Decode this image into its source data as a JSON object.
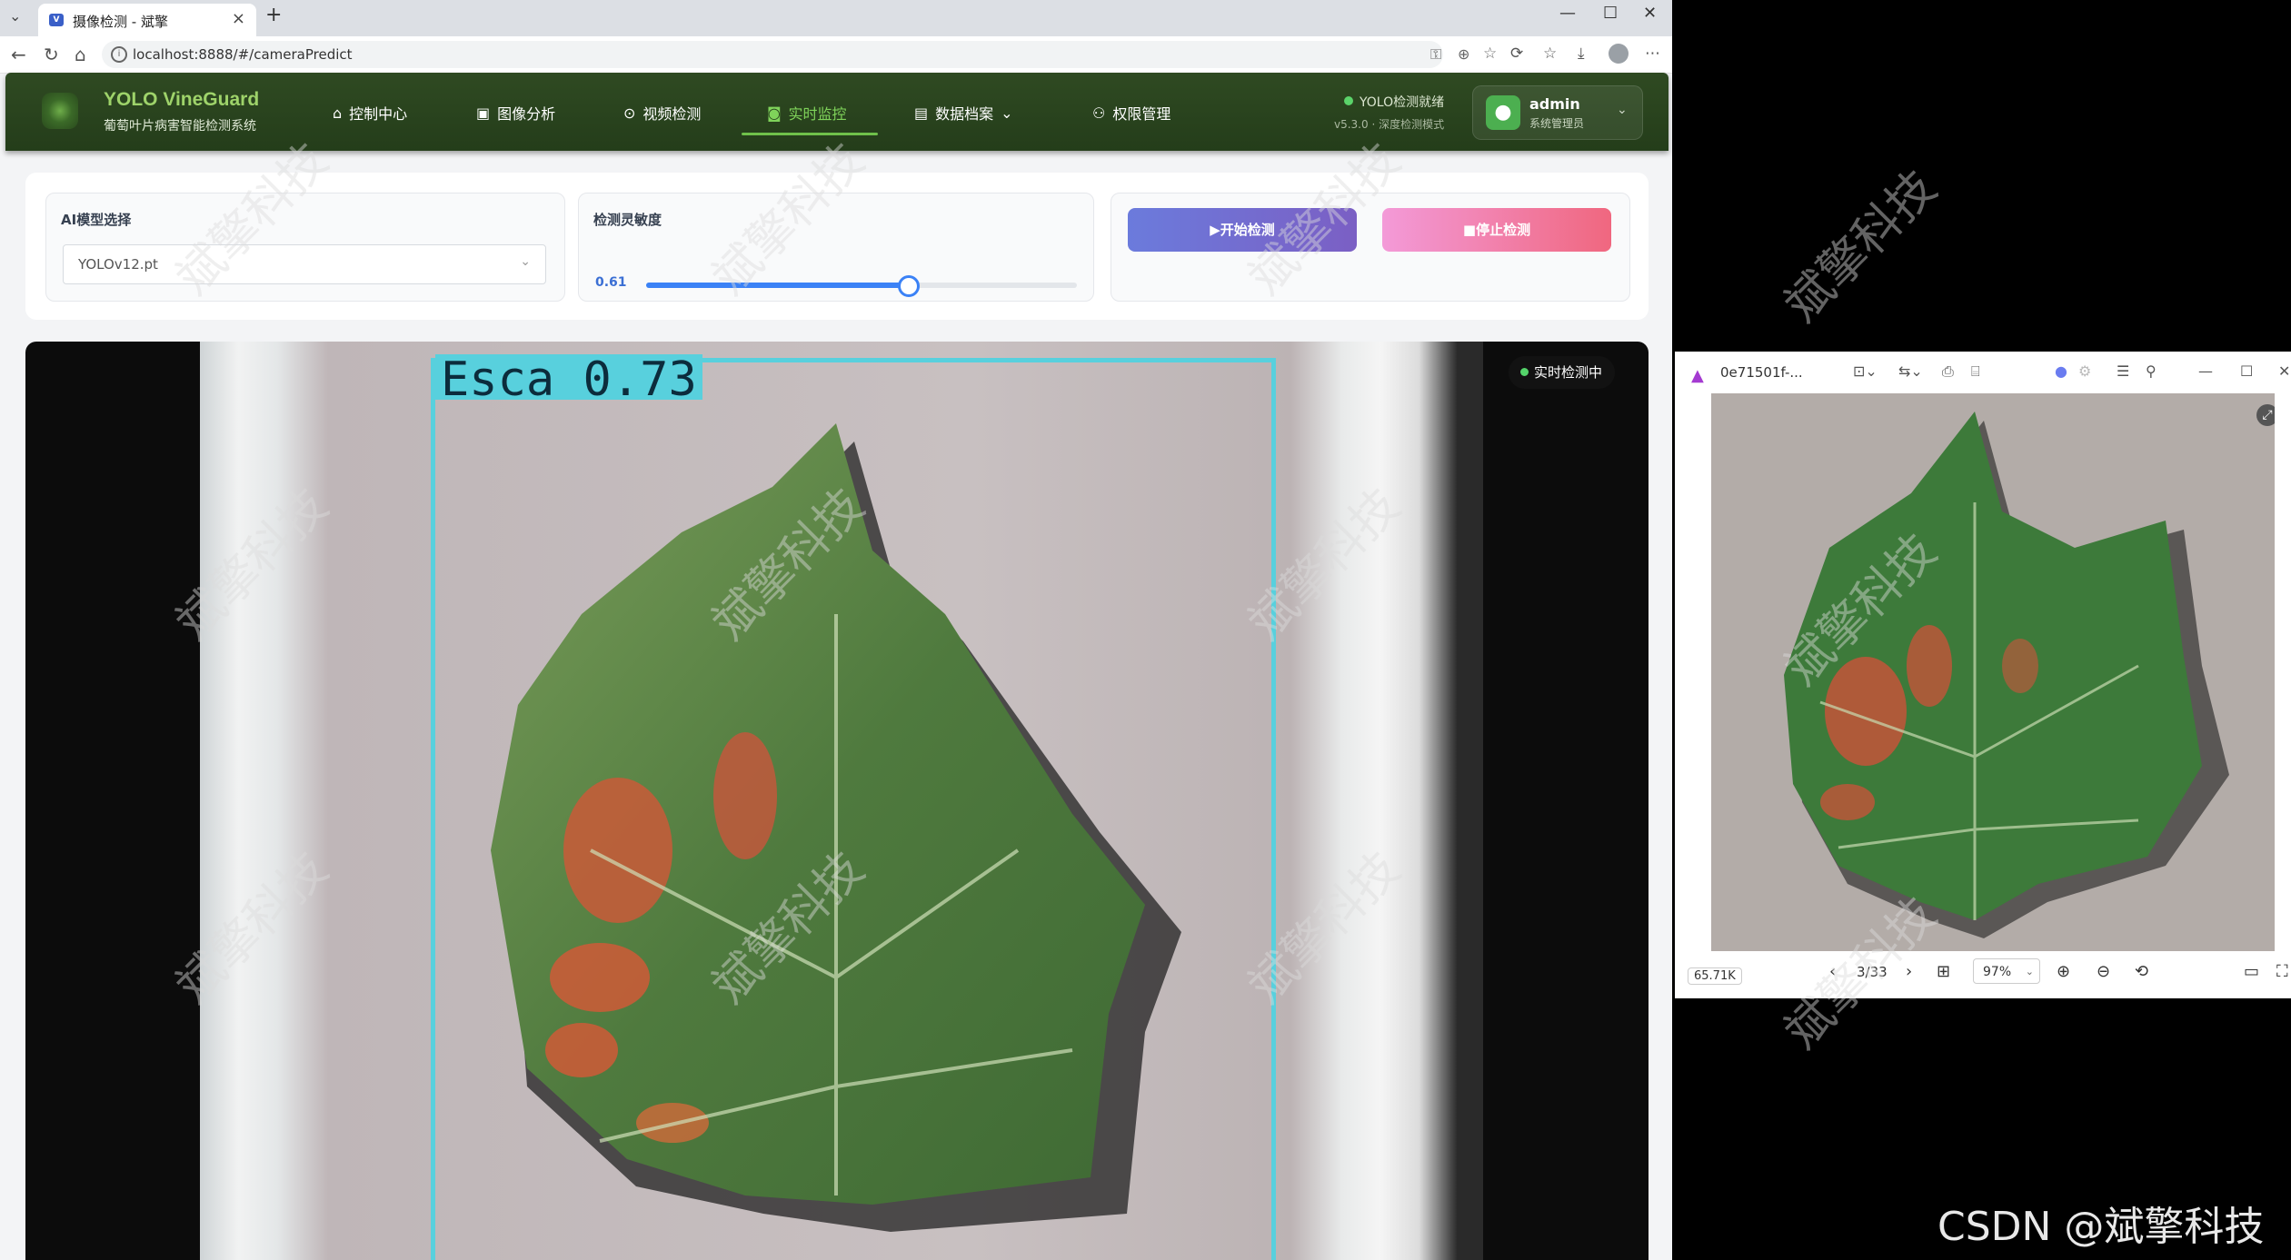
{
  "browser": {
    "tab_title": "摄像检测 - 斌擎",
    "tab_icon": "vue-favicon",
    "url": "localhost:8888/#/cameraPredict",
    "window_controls": [
      "—",
      "☐",
      "✕"
    ]
  },
  "app": {
    "brand_name": "YOLO VineGuard",
    "brand_subtitle": "葡萄叶片病害智能检测系统",
    "nav": [
      {
        "label": "控制中心",
        "icon": "home-icon"
      },
      {
        "label": "图像分析",
        "icon": "image-icon"
      },
      {
        "label": "视频检测",
        "icon": "play-circle-icon"
      },
      {
        "label": "实时监控",
        "icon": "camera-icon",
        "active": true
      },
      {
        "label": "数据档案",
        "icon": "document-icon",
        "dropdown": true
      },
      {
        "label": "权限管理",
        "icon": "user-icon"
      }
    ],
    "status": {
      "label": "YOLO检测就绪",
      "version": "v5.3.0 · 深度检测模式"
    },
    "user": {
      "name": "admin",
      "role": "系统管理员"
    }
  },
  "controls": {
    "model": {
      "title": "AI模型选择",
      "value": "YOLOv12.pt"
    },
    "sensitivity": {
      "title": "检测灵敏度",
      "value_label": "0.61",
      "value": 0.61,
      "max": 1.0
    },
    "start_label": "▶开始检测",
    "stop_label": "■停止检测"
  },
  "video": {
    "detection": {
      "label": "Esca 0.73",
      "color": "#58d0dd"
    },
    "live_badge": "实时检测中"
  },
  "viewer": {
    "title": "0e71501f-...",
    "file_size": "65.71K",
    "page": "3/33",
    "zoom": "97%"
  },
  "watermark_text": "斌擎科技",
  "csdn_watermark": "CSDN @斌擎科技",
  "colors": {
    "accent_green": "#7fd35a",
    "header_bg": "#2f4a22",
    "box": "#58d0dd"
  }
}
